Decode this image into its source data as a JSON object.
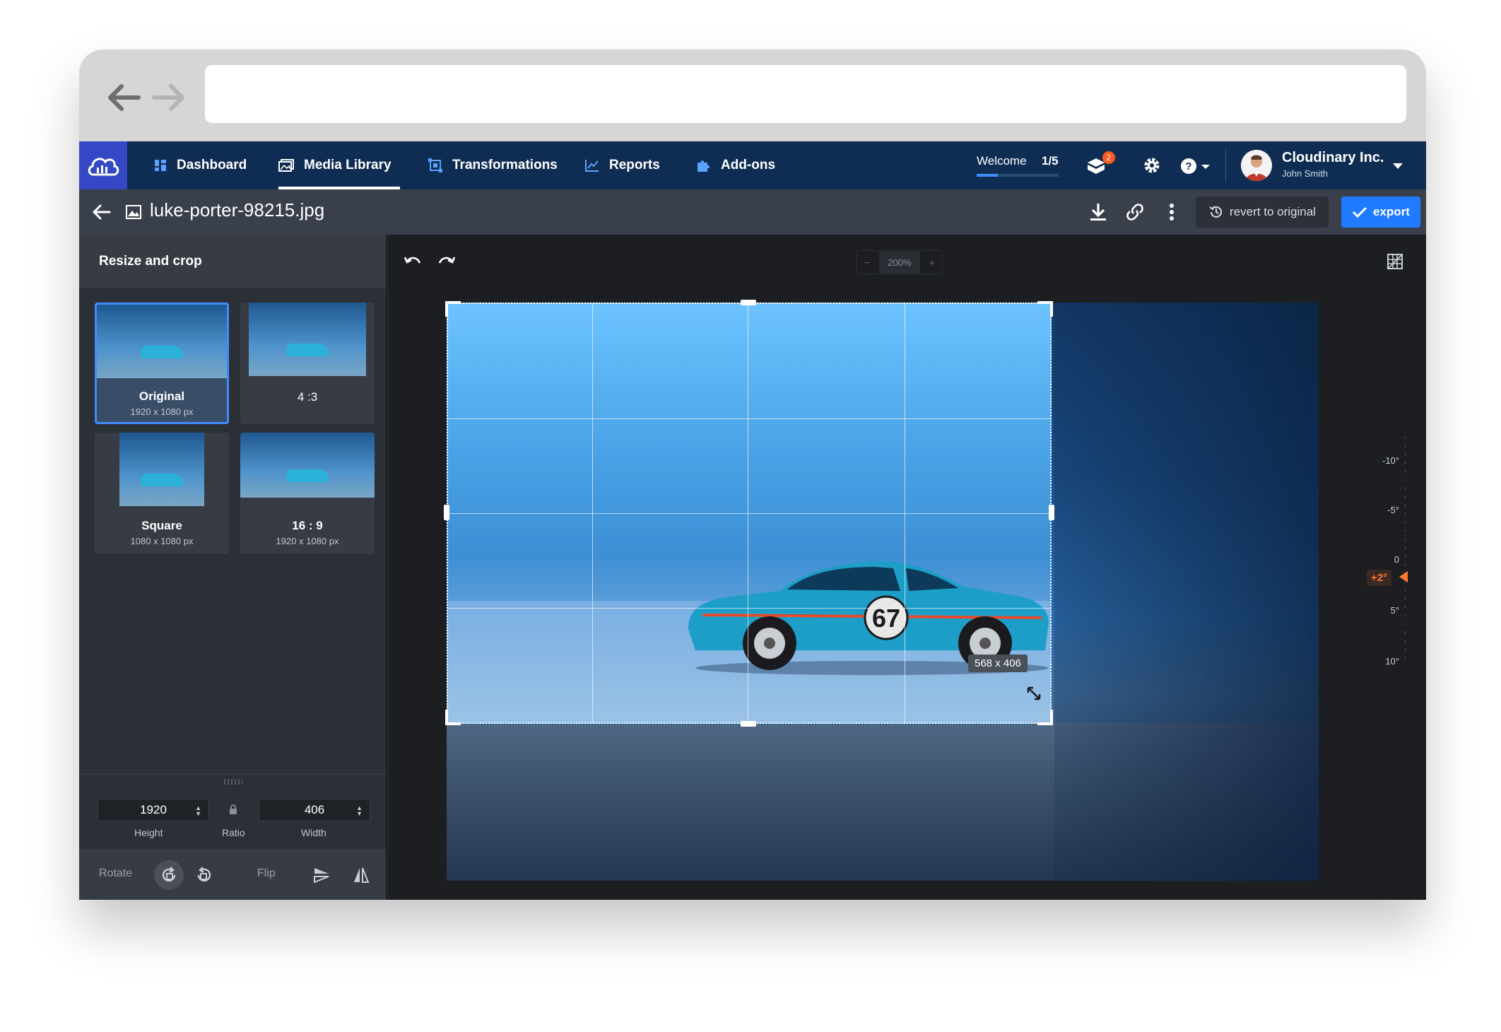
{
  "nav": {
    "items": [
      {
        "label": "Dashboard",
        "icon": "dashboard-icon"
      },
      {
        "label": "Media Library",
        "icon": "media-library-icon"
      },
      {
        "label": "Transformations",
        "icon": "transformations-icon"
      },
      {
        "label": "Reports",
        "icon": "reports-icon"
      },
      {
        "label": "Add-ons",
        "icon": "addons-icon"
      }
    ],
    "active": "Media Library",
    "welcome_label": "Welcome",
    "welcome_count": "1/5",
    "notification_count": "2",
    "account_name": "Cloudinary Inc.",
    "account_user": "John Smith"
  },
  "toolbar": {
    "filename": "luke-porter-98215.jpg",
    "revert_label": "revert to original",
    "export_label": "export"
  },
  "sidebar": {
    "title": "Resize and crop",
    "presets": [
      {
        "label": "Original",
        "size": "1920 x 1080 px",
        "active": true
      },
      {
        "label": "4 :3",
        "size": "",
        "active": false
      },
      {
        "label": "Square",
        "size": "1080 x 1080 px",
        "active": false
      },
      {
        "label": "16 : 9",
        "size": "1920 x 1080 px",
        "active": false
      }
    ],
    "height_value": "1920",
    "height_label": "Height",
    "ratio_label": "Ratio",
    "width_value": "406",
    "width_label": "Width",
    "rotate_label": "Rotate",
    "flip_label": "Flip"
  },
  "canvas": {
    "zoom": "200%",
    "crop_size": "568 x 406",
    "car_number": "67",
    "ruler": {
      "ticks": [
        "-10°",
        "-5°",
        "0",
        "5°",
        "10°"
      ],
      "current_angle": "+2°"
    }
  },
  "colors": {
    "nav_bg": "#0f2d52",
    "accent": "#1f7bff",
    "logo_bg": "#3448c5",
    "badge": "#ff5a1f",
    "angle": "#ff7a2e"
  }
}
